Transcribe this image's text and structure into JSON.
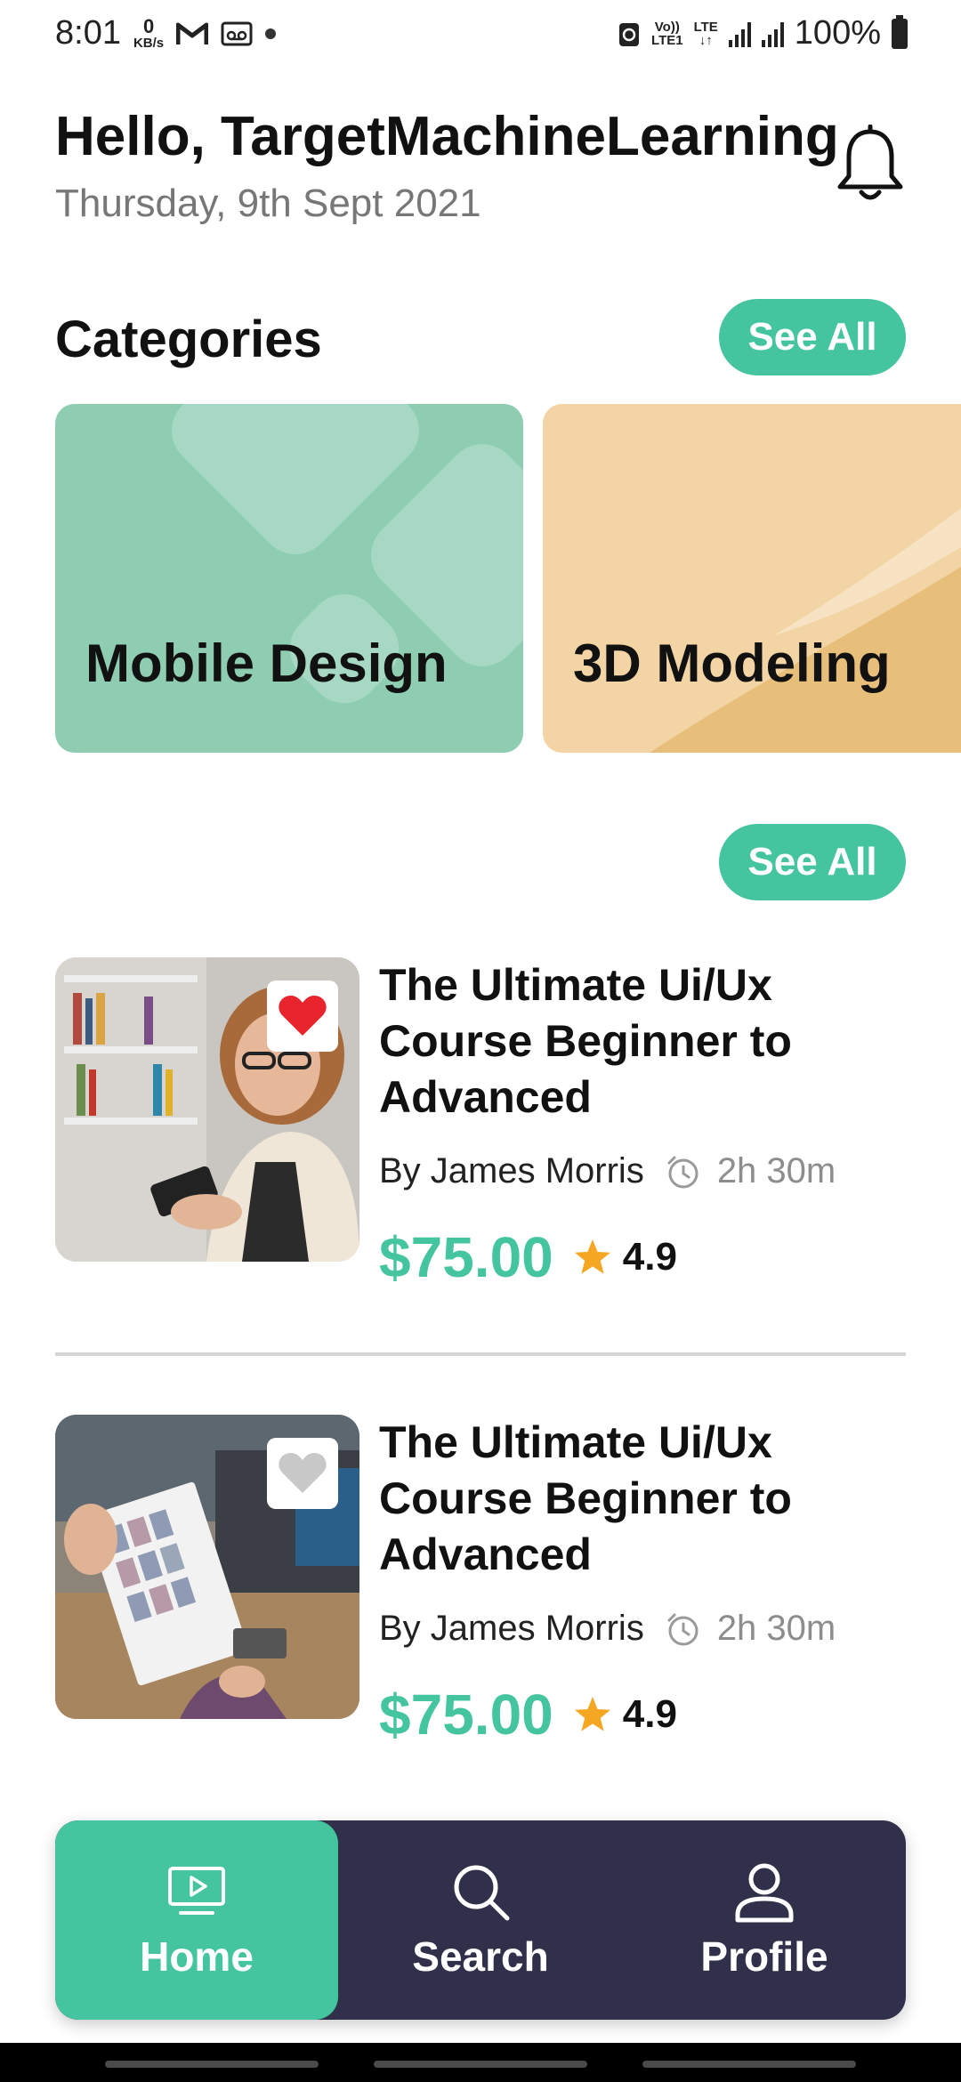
{
  "status_bar": {
    "time": "8:01",
    "net_speed_value": "0",
    "net_speed_unit": "KB/s",
    "volte_top": "Vo))",
    "volte_bottom": "LTE1",
    "lte_label": "LTE",
    "battery_percent": "100%"
  },
  "header": {
    "greeting": "Hello, TargetMachineLearning",
    "date": "Thursday, 9th Sept 2021"
  },
  "categories": {
    "title": "Categories",
    "see_all_label": "See All",
    "items": [
      {
        "label": "Mobile Design",
        "color": "#8ecdb2"
      },
      {
        "label": "3D Modeling",
        "color": "#f3d5a5"
      }
    ]
  },
  "courses": {
    "see_all_label": "See All",
    "items": [
      {
        "title": "The Ultimate Ui/Ux Course Beginner to Advanced",
        "author": "By James Morris",
        "duration": "2h 30m",
        "price": "$75.00",
        "rating": "4.9",
        "favorited": true
      },
      {
        "title": "The Ultimate Ui/Ux Course Beginner to Advanced",
        "author": "By James Morris",
        "duration": "2h 30m",
        "price": "$75.00",
        "rating": "4.9",
        "favorited": false
      }
    ]
  },
  "bottom_nav": {
    "items": [
      {
        "label": "Home",
        "icon": "monitor-play-icon",
        "active": true
      },
      {
        "label": "Search",
        "icon": "search-icon",
        "active": false
      },
      {
        "label": "Profile",
        "icon": "user-icon",
        "active": false
      }
    ]
  },
  "colors": {
    "accent": "#45c4a0",
    "nav_background": "#31304a",
    "heart_active": "#e8242c",
    "heart_inactive": "#c8c8c8",
    "star": "#f5a623"
  }
}
